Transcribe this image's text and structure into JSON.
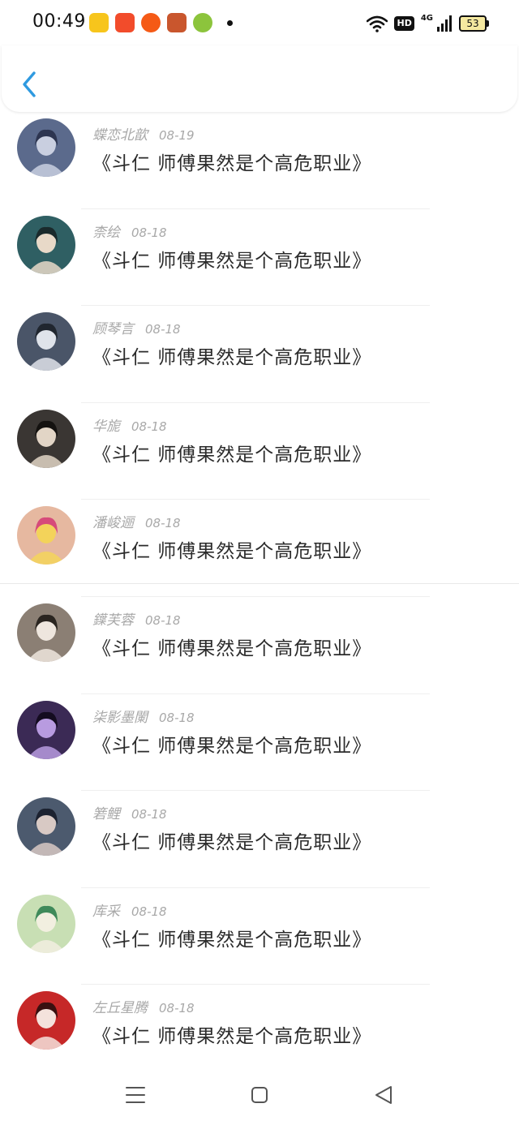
{
  "status_bar": {
    "time": "00:49",
    "network_type": "4G",
    "hd_label": "HD",
    "battery_level": "53",
    "app_icons": [
      {
        "name": "video-app-icon",
        "color": "#f7c51c"
      },
      {
        "name": "shopping-app-icon",
        "color": "#f24c2b"
      },
      {
        "name": "taobao-app-icon",
        "color": "#f55a16"
      },
      {
        "name": "game-app-icon",
        "color": "#c9562d"
      },
      {
        "name": "chat-app-icon",
        "color": "#8cc43c"
      }
    ]
  },
  "header": {
    "back_icon": "chevron-left-icon",
    "accent_color": "#2f9ae0"
  },
  "comments": [
    {
      "name": "蝶恋北歆",
      "date": "08-19",
      "text": "《斗仁 师傅果然是个高危职业》",
      "avatar_colors": [
        "#5b6a8c",
        "#c9cfe0",
        "#2d3550"
      ]
    },
    {
      "name": "柰绘",
      "date": "08-18",
      "text": "《斗仁 师傅果然是个高危职业》",
      "avatar_colors": [
        "#2f5f63",
        "#e8d9c8",
        "#1a2a2c"
      ]
    },
    {
      "name": "顾琴言",
      "date": "08-18",
      "text": "《斗仁 师傅果然是个高危职业》",
      "avatar_colors": [
        "#4a5568",
        "#dfe3ea",
        "#20262f"
      ]
    },
    {
      "name": "华旎",
      "date": "08-18",
      "text": "《斗仁 师傅果然是个高危职业》",
      "avatar_colors": [
        "#3a3633",
        "#e2d5c6",
        "#141210"
      ]
    },
    {
      "name": "潘峻逦",
      "date": "08-18",
      "text": "《斗仁 师傅果然是个高危职业》",
      "avatar_colors": [
        "#e6b8a0",
        "#f3d35a",
        "#d64b7a"
      ]
    },
    {
      "name": "鐷芙蓉",
      "date": "08-18",
      "text": "《斗仁 师傅果然是个高危职业》",
      "avatar_colors": [
        "#8b7f74",
        "#eee6de",
        "#2a2520"
      ]
    },
    {
      "name": "柒影墨闌",
      "date": "08-18",
      "text": "《斗仁 师傅果然是个高危职业》",
      "avatar_colors": [
        "#3b2a55",
        "#b89be0",
        "#140c20"
      ]
    },
    {
      "name": "箬鲤",
      "date": "08-18",
      "text": "《斗仁 师傅果然是个高危职业》",
      "avatar_colors": [
        "#4c5a6e",
        "#d8c9c4",
        "#1c2230"
      ]
    },
    {
      "name": "库采",
      "date": "08-18",
      "text": "《斗仁 师傅果然是个高危职业》",
      "avatar_colors": [
        "#c8dfb4",
        "#f2efe0",
        "#3f8a5a"
      ]
    },
    {
      "name": "左丘星腾",
      "date": "08-18",
      "text": "《斗仁 师傅果然是个高危职业》",
      "avatar_colors": [
        "#c62828",
        "#f4e2dc",
        "#3a1010"
      ]
    }
  ],
  "nav_bar": {
    "menu_icon": "menu-icon",
    "home_icon": "home-square-icon",
    "back_icon": "back-triangle-icon"
  }
}
